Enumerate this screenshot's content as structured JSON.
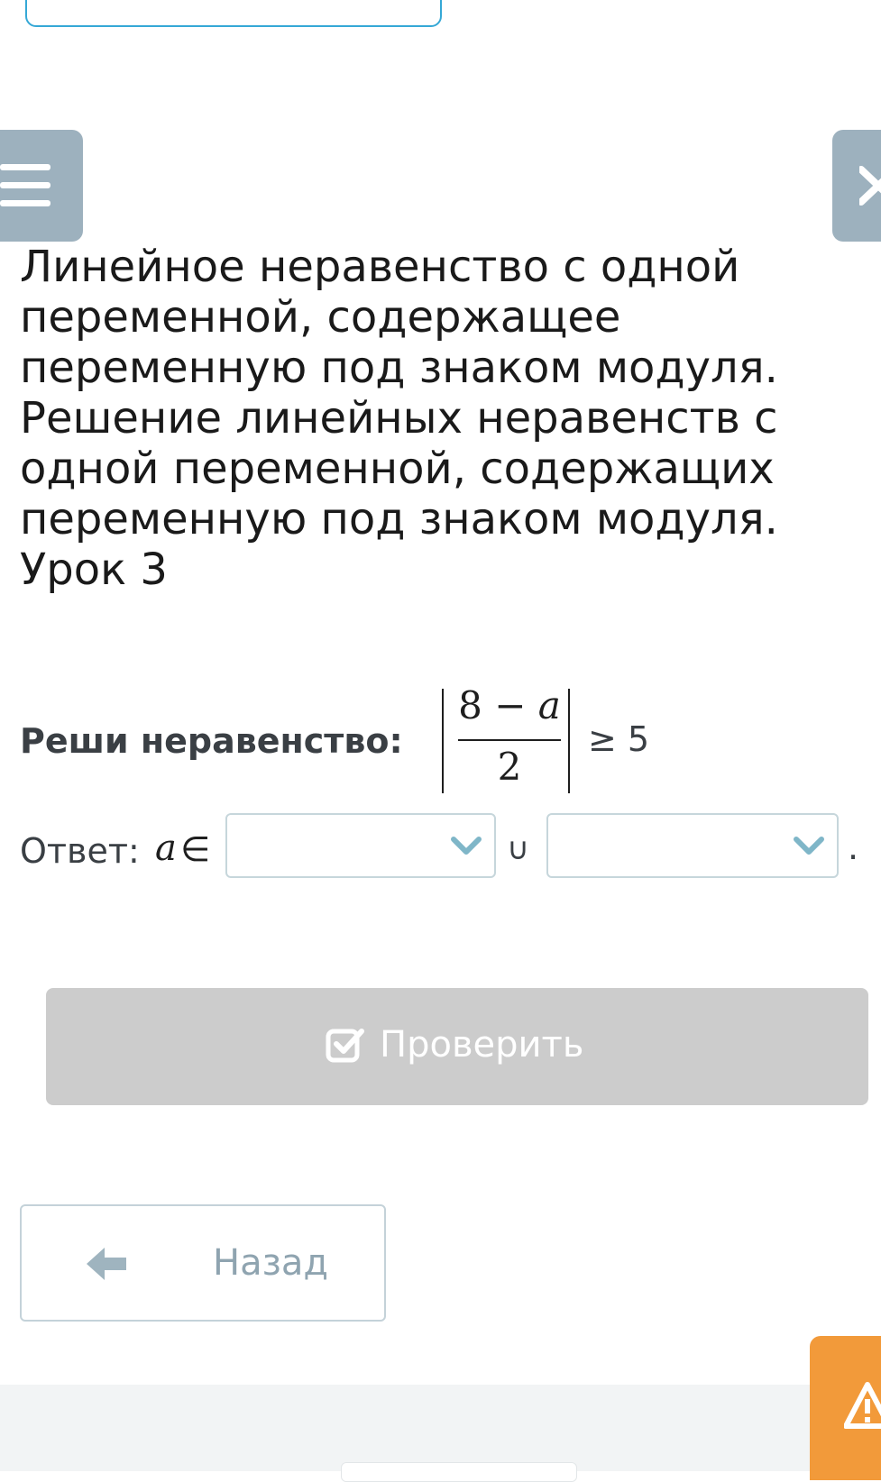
{
  "lesson": {
    "title": "Линейное неравенство с одной переменной, содержащее переменную под знаком модуля. Решение линейных неравенств с одной переменной, содержащих переменную под знаком модуля. Урок 3"
  },
  "task": {
    "label": "Реши неравенство:",
    "numerator_left": "8 − ",
    "numerator_var": "a",
    "denominator": "2",
    "relation": "≥ 5"
  },
  "answer": {
    "label": "Ответ:",
    "variable": "a",
    "element_of": "∈",
    "union": "∪",
    "end": ".",
    "select1_value": "",
    "select2_value": ""
  },
  "buttons": {
    "check": "Проверить",
    "back": "Назад"
  },
  "icons": {
    "menu": "menu-icon",
    "close": "close-icon",
    "chevron": "chevron-down-icon",
    "check": "checkbox-check-icon",
    "back": "arrow-left-icon",
    "alert": "warning-icon"
  },
  "colors": {
    "accent": "#35a8d6",
    "side_button": "#9db1be",
    "disabled_button": "#cccccc",
    "alert": "#f29a3a",
    "chevron": "#7fb6c8"
  }
}
